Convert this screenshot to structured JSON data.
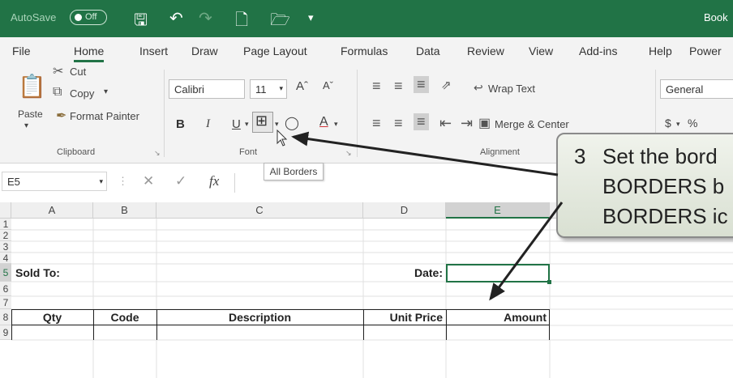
{
  "titlebar": {
    "autosave": "AutoSave",
    "toggle": "Off",
    "book": "Book",
    "icons": [
      "save-icon",
      "undo-icon",
      "redo-icon",
      "new-icon",
      "open-icon",
      "customize-icon"
    ]
  },
  "tabs": [
    "File",
    "Home",
    "Insert",
    "Draw",
    "Page Layout",
    "Formulas",
    "Data",
    "Review",
    "View",
    "Add-ins",
    "Help",
    "Power"
  ],
  "active_tab": "Home",
  "clipboard": {
    "paste": "Paste",
    "cut": "Cut",
    "copy": "Copy",
    "format_painter": "Format Painter",
    "label": "Clipboard"
  },
  "font": {
    "name": "Calibri",
    "size": "11",
    "bold": "B",
    "italic": "I",
    "underline": "U",
    "label": "Font",
    "tooltip": "All Borders"
  },
  "alignment": {
    "wrap": "Wrap Text",
    "merge": "Merge & Center",
    "label": "Alignment"
  },
  "number": {
    "format": "General",
    "currency": "$",
    "percent": "%"
  },
  "formula_bar": {
    "name_box": "E5",
    "fx": "fx"
  },
  "columns": [
    "A",
    "B",
    "C",
    "D",
    "E"
  ],
  "rows": [
    "1",
    "2",
    "3",
    "4",
    "5",
    "6",
    "7",
    "8",
    "9"
  ],
  "cells": {
    "sold_to": "Sold To:",
    "date": "Date:",
    "qty": "Qty",
    "code": "Code",
    "description": "Description",
    "unit_price": "Unit Price",
    "amount": "Amount"
  },
  "callout": {
    "number": "3",
    "line1": "Set the bord",
    "line2": "BORDERS b",
    "line3": "BORDERS ic"
  }
}
